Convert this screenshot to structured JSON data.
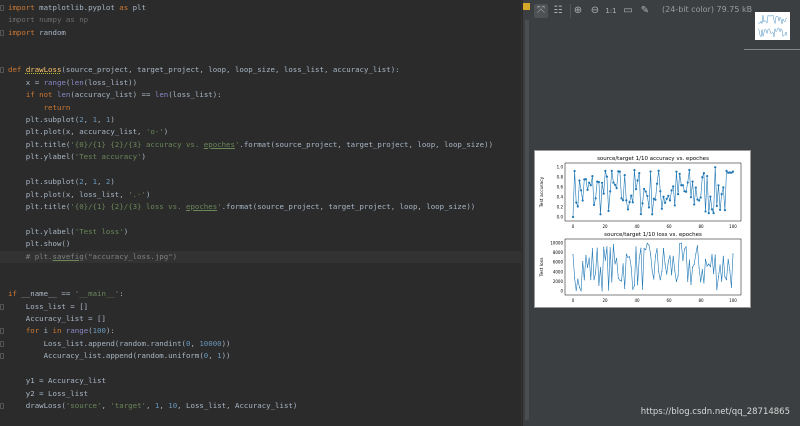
{
  "editor": {
    "current_line": 21,
    "lines": [
      [
        [
          "import",
          "kw"
        ],
        [
          " matplotlib.pyplot ",
          ""
        ],
        [
          "as",
          "kw"
        ],
        [
          " plt",
          ""
        ]
      ],
      [
        [
          "import numpy as np",
          "un"
        ]
      ],
      [
        [
          "import",
          "kw"
        ],
        [
          " random",
          ""
        ]
      ],
      [],
      [],
      [
        [
          "def ",
          "kw"
        ],
        [
          "drawLoss",
          "fn"
        ],
        [
          "(source_project, target_project, loop, loop_size, loss_list, accuracy_list):",
          ""
        ]
      ],
      [
        [
          "    x = ",
          ""
        ],
        [
          "range",
          "bi"
        ],
        [
          "(",
          ""
        ],
        [
          "len",
          "bi"
        ],
        [
          "(loss_list))",
          ""
        ]
      ],
      [
        [
          "    ",
          ""
        ],
        [
          "if not ",
          "kw"
        ],
        [
          "len",
          "bi"
        ],
        [
          "(accuracy_list) == ",
          ""
        ],
        [
          "len",
          "bi"
        ],
        [
          "(loss_list):",
          ""
        ]
      ],
      [
        [
          "        ",
          ""
        ],
        [
          "return",
          "kw"
        ]
      ],
      [
        [
          "    plt.subplot(",
          ""
        ],
        [
          "2",
          "num"
        ],
        [
          ", ",
          ""
        ],
        [
          "1",
          "num"
        ],
        [
          ", ",
          ""
        ],
        [
          "1",
          "num"
        ],
        [
          ")",
          ""
        ]
      ],
      [
        [
          "    plt.plot(x, accuracy_list, ",
          ""
        ],
        [
          "'o-'",
          "str"
        ],
        [
          ")",
          ""
        ]
      ],
      [
        [
          "    plt.title(",
          ""
        ],
        [
          "'{0}/{1} {2}/{3} accuracy vs. ",
          "str"
        ],
        [
          "epoches",
          "str ul"
        ],
        [
          "'",
          "str"
        ],
        [
          ".format(source_project, target_project, loop, loop_size))",
          ""
        ]
      ],
      [
        [
          "    plt.ylabel(",
          ""
        ],
        [
          "'Test accuracy'",
          "str"
        ],
        [
          ")",
          ""
        ]
      ],
      [],
      [
        [
          "    plt.subplot(",
          ""
        ],
        [
          "2",
          "num"
        ],
        [
          ", ",
          ""
        ],
        [
          "1",
          "num"
        ],
        [
          ", ",
          ""
        ],
        [
          "2",
          "num"
        ],
        [
          ")",
          ""
        ]
      ],
      [
        [
          "    plt.plot(x, loss_list, ",
          ""
        ],
        [
          "'.-'",
          "str"
        ],
        [
          ")",
          ""
        ]
      ],
      [
        [
          "    plt.title(",
          ""
        ],
        [
          "'{0}/{1} {2}/{3} loss vs. ",
          "str"
        ],
        [
          "epoches",
          "str ul"
        ],
        [
          "'",
          "str"
        ],
        [
          ".format(source_project, target_project, loop, loop_size))",
          ""
        ]
      ],
      [],
      [
        [
          "    plt.ylabel(",
          ""
        ],
        [
          "'Test loss'",
          "str"
        ],
        [
          ")",
          ""
        ]
      ],
      [
        [
          "    plt.show()",
          ""
        ]
      ],
      [
        [
          "    # plt.",
          "cm"
        ],
        [
          "savefig",
          "cm ul"
        ],
        [
          "(\"accuracy_loss.jpg\")",
          "cm"
        ]
      ],
      [],
      [],
      [
        [
          "if ",
          "kw"
        ],
        [
          "__name__ == ",
          ""
        ],
        [
          "'__main__'",
          "str"
        ],
        [
          ":",
          ""
        ]
      ],
      [
        [
          "    Loss_list = []",
          ""
        ]
      ],
      [
        [
          "    Accuracy_list = []",
          ""
        ]
      ],
      [
        [
          "    ",
          ""
        ],
        [
          "for ",
          "kw"
        ],
        [
          "i ",
          ""
        ],
        [
          "in ",
          "kw"
        ],
        [
          "range",
          "bi"
        ],
        [
          "(",
          ""
        ],
        [
          "100",
          "num"
        ],
        [
          "):",
          ""
        ]
      ],
      [
        [
          "        Loss_list.append(random.randint(",
          ""
        ],
        [
          "0",
          "num"
        ],
        [
          ", ",
          ""
        ],
        [
          "10000",
          "num"
        ],
        [
          "))",
          ""
        ]
      ],
      [
        [
          "        Accuracy_list.append(random.uniform(",
          ""
        ],
        [
          "0",
          "num"
        ],
        [
          ", ",
          ""
        ],
        [
          "1",
          "num"
        ],
        [
          "))",
          ""
        ]
      ],
      [],
      [
        [
          "    y1 = Accuracy_list",
          ""
        ]
      ],
      [
        [
          "    y2 = Loss_list",
          ""
        ]
      ],
      [
        [
          "    drawLoss(",
          ""
        ],
        [
          "'source'",
          "str"
        ],
        [
          ", ",
          ""
        ],
        [
          "'target'",
          "str"
        ],
        [
          ", ",
          ""
        ],
        [
          "1",
          "num"
        ],
        [
          ", ",
          ""
        ],
        [
          "10",
          "num"
        ],
        [
          ", Loss_list, Accuracy_list)",
          ""
        ]
      ]
    ]
  },
  "viewer": {
    "toolbar": [
      {
        "icon": "fit-zoom-icon",
        "glyph": "⤧",
        "active": true
      },
      {
        "icon": "grid-icon",
        "glyph": "☷"
      },
      {
        "icon": "zoom-in-icon",
        "glyph": "⊕"
      },
      {
        "icon": "zoom-out-icon",
        "glyph": "⊖"
      },
      {
        "icon": "actual-size-icon",
        "glyph": "1:1"
      },
      {
        "icon": "background-icon",
        "glyph": "▭"
      },
      {
        "icon": "color-picker-icon",
        "glyph": "✎"
      }
    ],
    "info": "(24-bit color) 79.75 kB",
    "image": {
      "top_title": "source/target 1/10 accuracy vs. epoches",
      "top_ylabel": "Test accuracy",
      "top_yticks": [
        "0.0",
        "0.2",
        "0.4",
        "0.6",
        "0.8",
        "1.0"
      ],
      "bottom_title": "source/target 1/10 loss vs. epoches",
      "bottom_ylabel": "Test loss",
      "bottom_yticks": [
        "0",
        "2000",
        "4000",
        "6000",
        "8000",
        "10000"
      ],
      "xticks": [
        "0",
        "20",
        "40",
        "60",
        "80",
        "100"
      ],
      "line_color": "#1f77b4"
    }
  },
  "watermark": "https://blog.csdn.net/qq_28714865"
}
